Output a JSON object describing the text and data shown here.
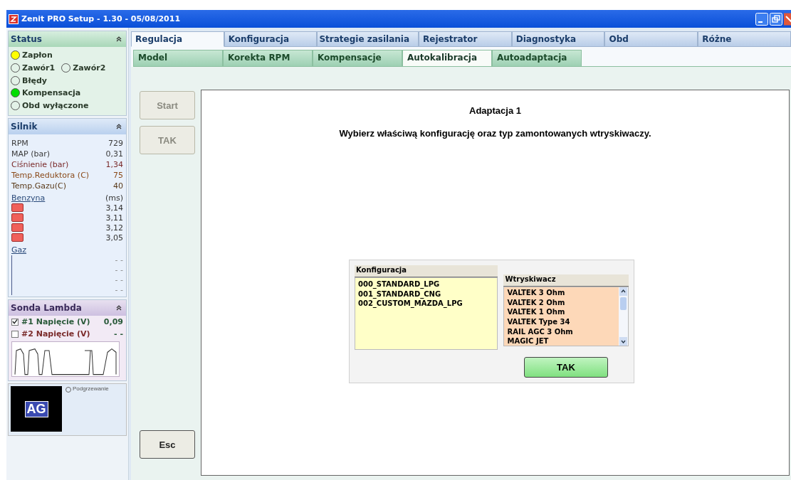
{
  "window": {
    "title": "Zenit PRO Setup - 1.30 - 05/08/2011"
  },
  "status": {
    "title": "Status",
    "items": [
      {
        "label": "Zapłon",
        "on": true,
        "color": "#ffff00"
      },
      {
        "label": "Zawór1",
        "on": false
      },
      {
        "label": "Zawór2",
        "on": false
      },
      {
        "label": "Błędy",
        "on": false
      },
      {
        "label": "Kompensacja",
        "on": true,
        "color": "#00dd00"
      },
      {
        "label": "Obd wyłączone",
        "on": false
      }
    ]
  },
  "engine": {
    "title": "Silnik",
    "rows": [
      {
        "label": "RPM",
        "value": "729",
        "color": "#3a3a3a"
      },
      {
        "label": "MAP (bar)",
        "value": "0,31",
        "color": "#3a3a3a"
      },
      {
        "label": "Ciśnienie (bar)",
        "value": "1,34",
        "color": "#7a2a2a"
      },
      {
        "label": "Temp.Reduktora (C)",
        "value": "75",
        "color": "#8a4a1a"
      },
      {
        "label": "Temp.Gazu(C)",
        "value": "40",
        "color": "#5a3a1a"
      }
    ],
    "petrol": {
      "title": "Benzyna",
      "unit": "(ms)",
      "values": [
        "3,14",
        "3,11",
        "3,12",
        "3,05"
      ]
    },
    "gas": {
      "title": "Gaz",
      "values": [
        "- -",
        "- -",
        "- -",
        "- -"
      ]
    }
  },
  "lambda": {
    "title": "Sonda Lambda",
    "rows": [
      {
        "label": "#1 Napięcie (V)",
        "value": "0,09",
        "checked": true
      },
      {
        "label": "#2 Napięcie (V)",
        "value": "- -",
        "checked": false
      }
    ]
  },
  "heater": {
    "logo": "AG",
    "label": "Podgrzewanie",
    "on": false
  },
  "tabs": [
    {
      "label": "Regulacja",
      "selected": true
    },
    {
      "label": "Konfiguracja",
      "selected": false
    },
    {
      "label": "Strategie zasilania",
      "selected": false
    },
    {
      "label": "Rejestrator",
      "selected": false
    },
    {
      "label": "Diagnostyka",
      "selected": false
    },
    {
      "label": "Obd",
      "selected": false
    },
    {
      "label": "Różne",
      "selected": false
    }
  ],
  "subtabs": [
    {
      "label": "Model",
      "selected": false
    },
    {
      "label": "Korekta RPM",
      "selected": false
    },
    {
      "label": "Kompensacje",
      "selected": false
    },
    {
      "label": "Autokalibracja",
      "selected": true
    },
    {
      "label": "Autoadaptacja",
      "selected": false
    }
  ],
  "side_buttons": [
    {
      "label": "Start",
      "disabled": true
    },
    {
      "label": "TAK",
      "disabled": true
    }
  ],
  "esc_button": "Esc",
  "content": {
    "title": "Adaptacja 1",
    "instruction": "Wybierz właściwą konfigurację oraz typ zamontowanych wtryskiwaczy.",
    "dialog": {
      "config_label": "Konfiguracja",
      "configs": [
        "000_STANDARD_LPG",
        "001_STANDARD_CNG",
        "002_CUSTOM_MAZDA_LPG"
      ],
      "injector_label": "Wtryskiwacz",
      "injectors": [
        "VALTEK 3 Ohm",
        "VALTEK 2 Ohm",
        "VALTEK 1 Ohm",
        "VALTEK Type 34",
        "RAIL AGC 3 Ohm",
        "MAGIC JET"
      ],
      "ok_button": "TAK"
    }
  }
}
